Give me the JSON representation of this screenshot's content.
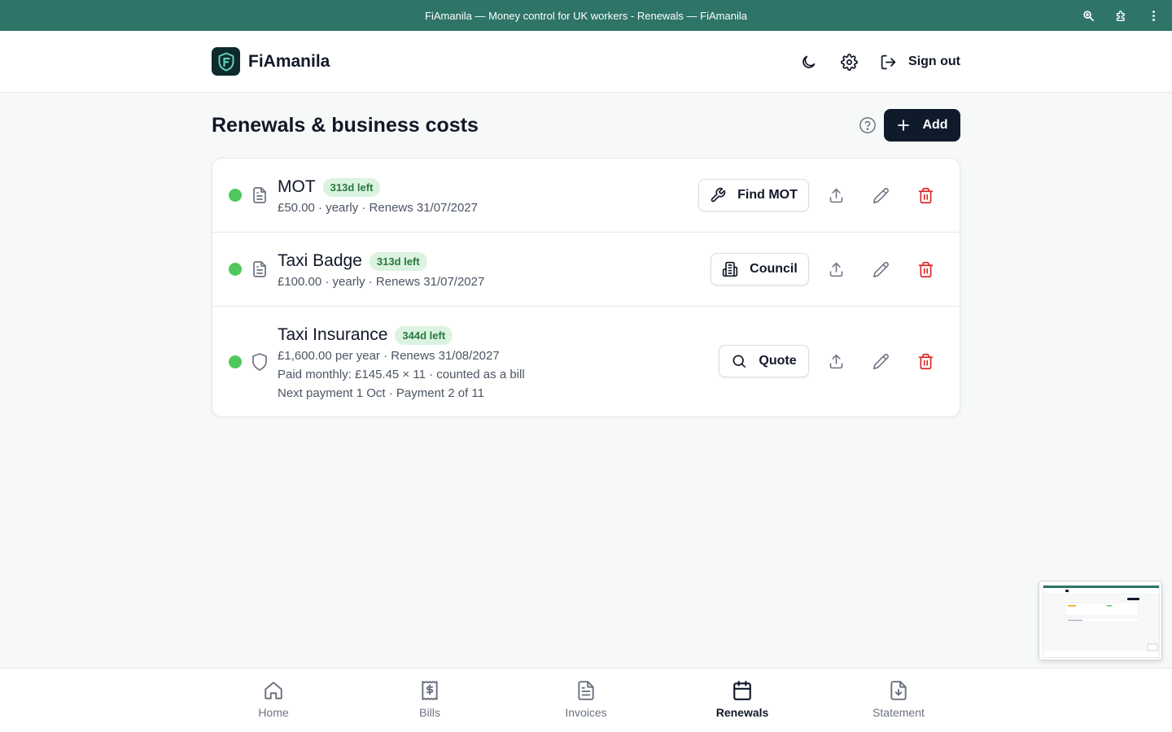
{
  "browser": {
    "title": "FiAmanila — Money control for UK workers - Renewals — FiAmanila",
    "tools": [
      "zoom-icon",
      "extensions-icon",
      "more-vertical-icon"
    ]
  },
  "header": {
    "brand_name": "FiAmanila",
    "theme_icon": "moon-icon",
    "settings_icon": "gear-icon",
    "sign_out_label": "Sign out"
  },
  "page": {
    "title": "Renewals & business costs",
    "add_label": "Add"
  },
  "renewals": [
    {
      "name": "MOT",
      "badge": "313d left",
      "status": "green",
      "icon": "document-icon",
      "lines": [
        "£50.00 · yearly · Renews 31/07/2027"
      ],
      "action_label": "Find MOT",
      "action_icon": "wrench-icon"
    },
    {
      "name": "Taxi Badge",
      "badge": "313d left",
      "status": "green",
      "icon": "document-icon",
      "lines": [
        "£100.00 · yearly · Renews 31/07/2027"
      ],
      "action_label": "Council",
      "action_icon": "building-icon"
    },
    {
      "name": "Taxi Insurance",
      "badge": "344d left",
      "status": "green",
      "icon": "shield-icon",
      "lines": [
        "£1,600.00 per year · Renews 31/08/2027",
        "Paid monthly: £145.45 × 11 · counted as a bill",
        "Next payment 1 Oct · Payment 2 of 11"
      ],
      "action_label": "Quote",
      "action_icon": "search-icon"
    }
  ],
  "nav": [
    {
      "label": "Home",
      "icon": "home-icon",
      "active": false
    },
    {
      "label": "Bills",
      "icon": "bills-icon",
      "active": false
    },
    {
      "label": "Invoices",
      "icon": "invoice-icon",
      "active": false
    },
    {
      "label": "Renewals",
      "icon": "calendar-icon",
      "active": true
    },
    {
      "label": "Statement",
      "icon": "statement-icon",
      "active": false
    }
  ],
  "colors": {
    "titlebar": "#2e7468",
    "primary_button": "#0f1b2b",
    "status_green": "#4fc85a",
    "badge_bg": "#dcf3e2",
    "badge_text": "#267a3a",
    "danger": "#dc2626"
  }
}
